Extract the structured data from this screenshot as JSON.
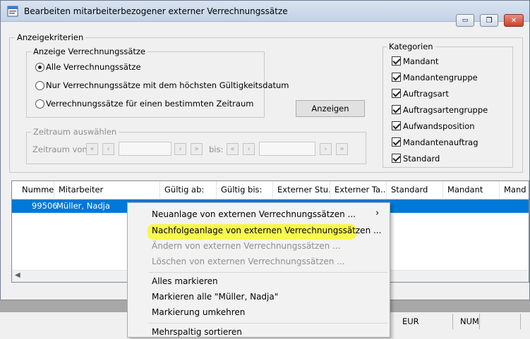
{
  "window": {
    "title": "Bearbeiten mitarbeiterbezogener externer Verrechnungssätze",
    "minimize": "▭",
    "restore": "❐",
    "close": "✕"
  },
  "criteria": {
    "label": "Anzeigekriterien",
    "display_group": {
      "label": "Anzeige Verrechnungssätze",
      "options": [
        {
          "label": "Alle Verrechnungssätze",
          "selected": true
        },
        {
          "label": "Nur Verrechnungssätze mit dem höchsten Gültigkeitsdatum",
          "selected": false
        },
        {
          "label": "Verrechnungssätze für einen bestimmten Zeitraum",
          "selected": false
        }
      ]
    },
    "show_button": "Anzeigen",
    "period_group": {
      "label": "Zeitraum auswählen",
      "from_label": "Zeitraum von:",
      "to_label": "bis:",
      "first": "«",
      "prev": "‹",
      "next": "›",
      "last": "»"
    }
  },
  "categories": {
    "label": "Kategorien",
    "items": [
      "Mandant",
      "Mandantengruppe",
      "Auftragsart",
      "Auftragsartengruppe",
      "Aufwandsposition",
      "Mandantenauftrag",
      "Standard"
    ]
  },
  "table": {
    "columns": [
      "Nummer",
      "Mitarbeiter",
      "Gültig ab:",
      "Gültig bis:",
      "Externer Stu...",
      "Externer Ta...",
      "Standard",
      "Mandant",
      "Mand"
    ],
    "rows": [
      {
        "nummer": "99506",
        "mitarbeiter": "Müller, Nadja"
      }
    ]
  },
  "context_menu": {
    "items": [
      {
        "label": "Neuanlage von externen Verrechnungssätzen ...",
        "enabled": true,
        "submenu": "›"
      },
      {
        "label": "Nachfolgeanlage von externen Verrechnungssätzen ...",
        "enabled": true
      },
      {
        "label": "Ändern von externen Verrechnungssätzen ...",
        "enabled": false
      },
      {
        "label": "Löschen von externen Verrechnungssätzen ...",
        "enabled": false
      },
      {
        "label": "Alles markieren",
        "enabled": true
      },
      {
        "label": "Markieren alle \"Müller, Nadja\"",
        "enabled": true
      },
      {
        "label": "Markierung umkehren",
        "enabled": true
      },
      {
        "label": "Mehrspaltig sortieren",
        "enabled": true
      }
    ]
  },
  "statusbar": {
    "currency": "EUR",
    "numlock": "NUM"
  },
  "colors": {
    "selection": "#0078d7",
    "highlight": "#f9f930"
  }
}
